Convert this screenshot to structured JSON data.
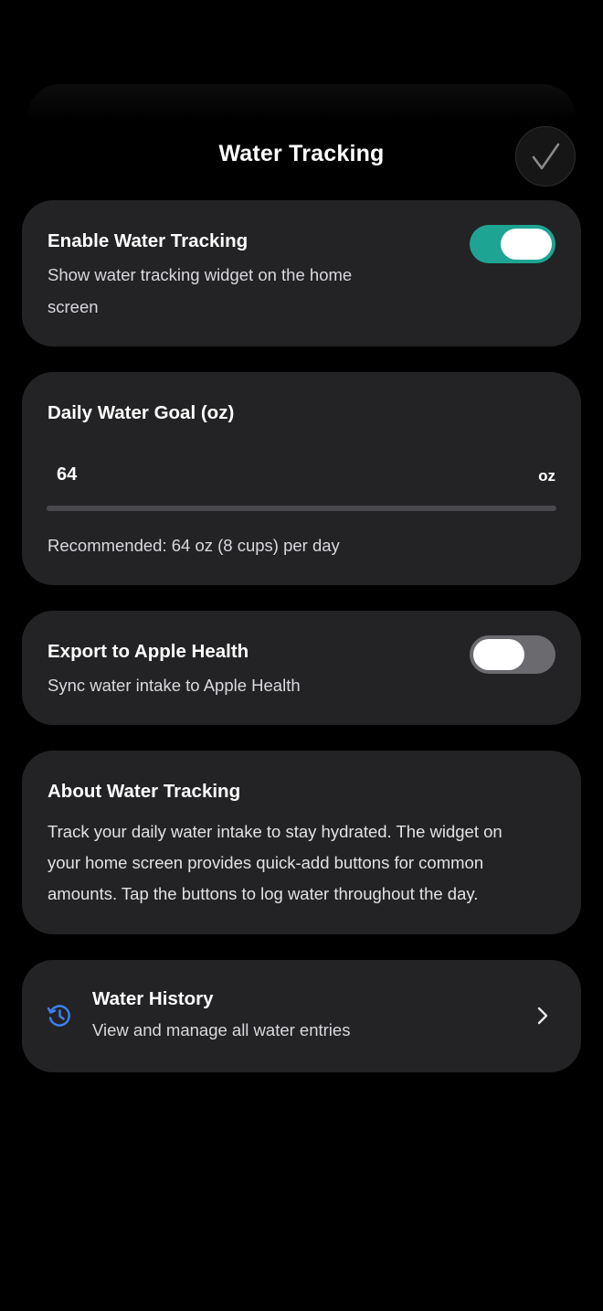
{
  "header": {
    "title": "Water Tracking",
    "done_icon": "checkmark-icon"
  },
  "enable_tracking": {
    "title": "Enable Water Tracking",
    "description_line1": "Show water tracking widget on the home",
    "description_line2": "screen",
    "enabled": true
  },
  "daily_goal": {
    "title": "Daily Water Goal (oz)",
    "value": "64",
    "unit": "oz",
    "hint": "Recommended: 64 oz (8 cups) per day"
  },
  "apple_health": {
    "title": "Export to Apple Health",
    "description": "Sync water intake to Apple Health",
    "enabled": false
  },
  "about": {
    "title": "About Water Tracking",
    "line1": "Track your daily water intake to stay hydrated. The widget on",
    "line2": "your home screen provides quick-add buttons for common",
    "line3": "amounts. Tap the buttons to log water throughout the day."
  },
  "history": {
    "title": "Water History",
    "description": "View and manage all water entries",
    "icon": "history-icon",
    "chevron_icon": "chevron-right-icon"
  },
  "colors": {
    "background": "#000000",
    "card": "#232325",
    "accent_toggle": "#1ea492",
    "toggle_off": "#6a6a6f",
    "history_icon": "#3d82f5"
  }
}
